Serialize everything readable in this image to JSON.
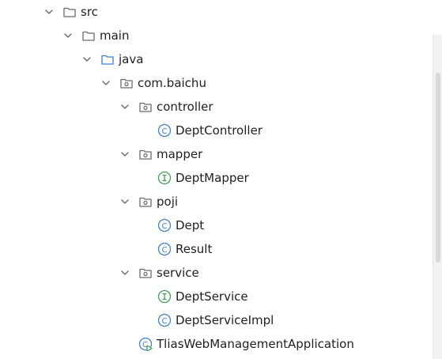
{
  "tree": {
    "nodes": [
      {
        "label": "src",
        "type": "folder",
        "depth": 0,
        "expanded": true
      },
      {
        "label": "main",
        "type": "folder",
        "depth": 1,
        "expanded": true
      },
      {
        "label": "java",
        "type": "source-folder",
        "depth": 2,
        "expanded": true
      },
      {
        "label": "com.baichu",
        "type": "package",
        "depth": 3,
        "expanded": true
      },
      {
        "label": "controller",
        "type": "package",
        "depth": 4,
        "expanded": true
      },
      {
        "label": "DeptController",
        "type": "class",
        "depth": 5
      },
      {
        "label": "mapper",
        "type": "package",
        "depth": 4,
        "expanded": true
      },
      {
        "label": "DeptMapper",
        "type": "interface",
        "depth": 5
      },
      {
        "label": "poji",
        "type": "package",
        "depth": 4,
        "expanded": true
      },
      {
        "label": "Dept",
        "type": "class",
        "depth": 5
      },
      {
        "label": "Result",
        "type": "class",
        "depth": 5
      },
      {
        "label": "service",
        "type": "package",
        "depth": 4,
        "expanded": true
      },
      {
        "label": "DeptService",
        "type": "interface",
        "depth": 5
      },
      {
        "label": "DeptServiceImpl",
        "type": "class",
        "depth": 5
      },
      {
        "label": "TliasWebManagementApplication",
        "type": "spring-app-class",
        "depth": 4
      }
    ]
  },
  "icons": {
    "folder": "folder-icon",
    "source-folder": "source-folder-icon",
    "package": "package-icon",
    "class": "class-icon",
    "interface": "interface-icon",
    "spring-app-class": "spring-app-class-icon",
    "chevron": "chevron-down-icon"
  },
  "colors": {
    "folder": "#6b6b6b",
    "source_folder": "#3c7fd6",
    "class": "#3c7fd6",
    "interface": "#3ea14f",
    "text": "#1f1f1f"
  }
}
